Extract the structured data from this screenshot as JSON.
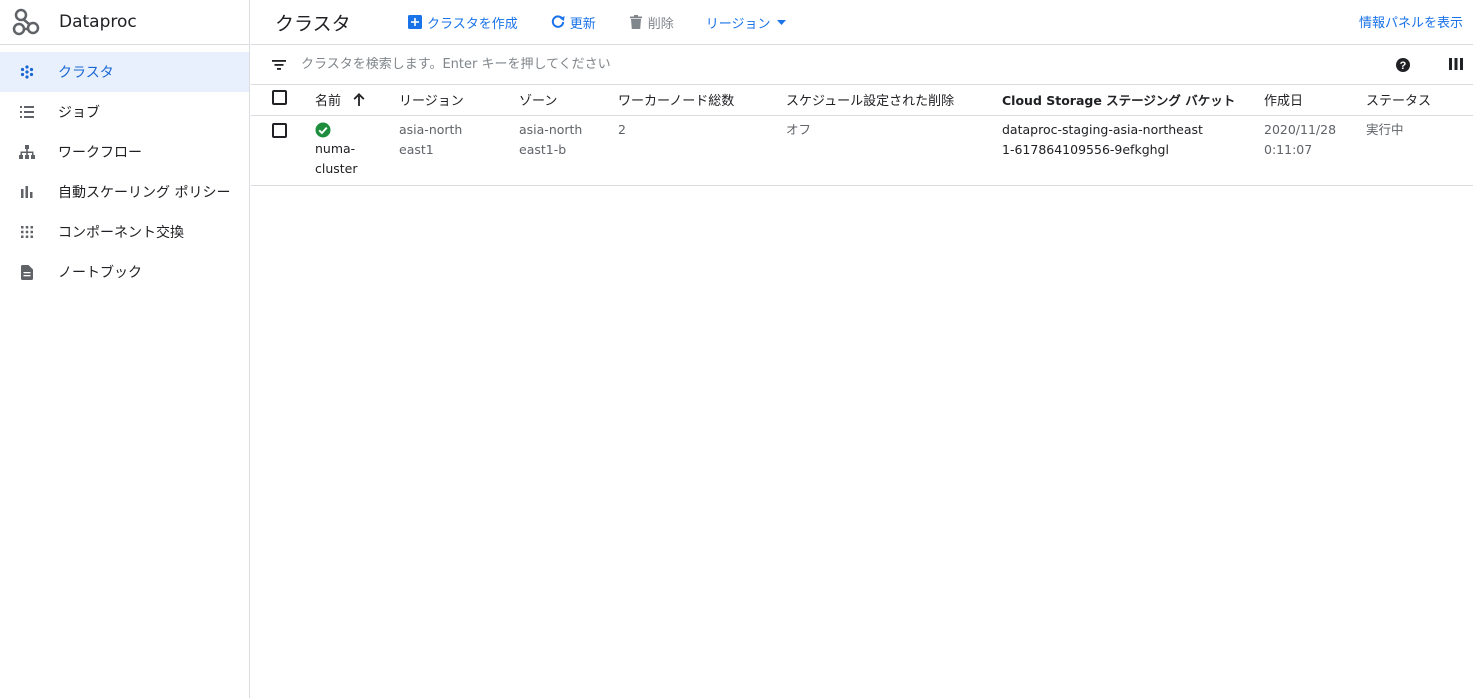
{
  "product": {
    "name": "Dataproc"
  },
  "nav": [
    {
      "label": "クラスタ",
      "icon": "cluster-icon",
      "active": true
    },
    {
      "label": "ジョブ",
      "icon": "list-icon"
    },
    {
      "label": "ワークフロー",
      "icon": "workflow-icon"
    },
    {
      "label": "自動スケーリング ポリシー",
      "icon": "bar-chart-icon"
    },
    {
      "label": "コンポーネント交換",
      "icon": "grid-icon"
    },
    {
      "label": "ノートブック",
      "icon": "document-icon"
    }
  ],
  "toolbar": {
    "title": "クラスタ",
    "create_label": "クラスタを作成",
    "refresh_label": "更新",
    "delete_label": "削除",
    "region_label": "リージョン",
    "info_panel_label": "情報パネルを表示"
  },
  "filter": {
    "placeholder": "クラスタを検索します。Enter キーを押してください"
  },
  "table": {
    "headers": {
      "name": "名前",
      "region": "リージョン",
      "zone": "ゾーン",
      "workers": "ワーカーノード総数",
      "scheduled_delete": "スケジュール設定された削除",
      "bucket": "Cloud Storage ステージング バケット",
      "created": "作成日",
      "status": "ステータス"
    },
    "rows": [
      {
        "name": "numa-cluster",
        "region": "asia-northeast1",
        "zone": "asia-northeast1-b",
        "workers": "2",
        "scheduled_delete": "オフ",
        "bucket": "dataproc-staging-asia-northeast1-617864109556-9efkghgl",
        "created": "2020/11/28 0:11:07",
        "status": "実行中"
      }
    ]
  },
  "colors": {
    "accent": "#1a73e8",
    "active_bg": "#e8f0fe",
    "status_ok": "#1e8e3e"
  }
}
